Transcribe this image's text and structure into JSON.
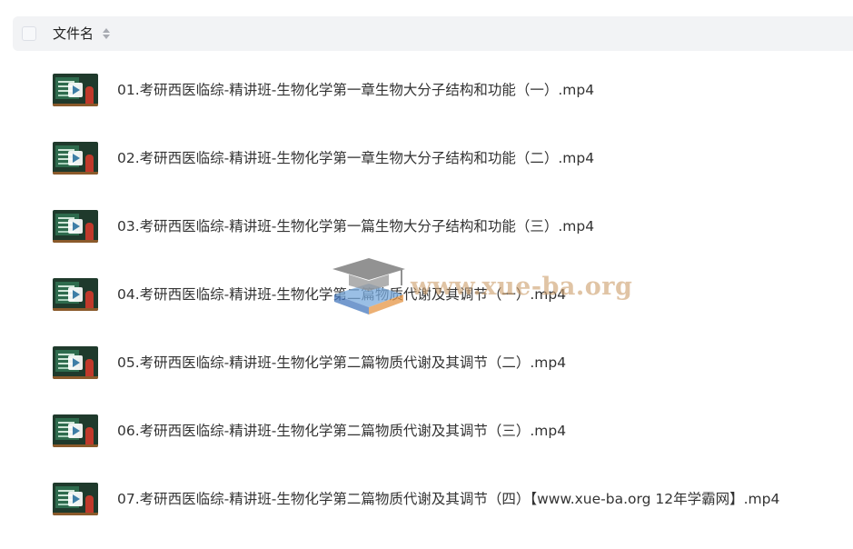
{
  "header": {
    "column_title": "文件名",
    "sort_icon": "sort-both-icon"
  },
  "files": [
    {
      "name": "01.考研西医临综-精讲班-生物化学第一章生物大分子结构和功能（一）.mp4"
    },
    {
      "name": "02.考研西医临综-精讲班-生物化学第一章生物大分子结构和功能（二）.mp4"
    },
    {
      "name": "03.考研西医临综-精讲班-生物化学第一篇生物大分子结构和功能（三）.mp4"
    },
    {
      "name": "04.考研西医临综-精讲班-生物化学第二篇物质代谢及其调节（一）.mp4"
    },
    {
      "name": "05.考研西医临综-精讲班-生物化学第二篇物质代谢及其调节（二）.mp4"
    },
    {
      "name": "06.考研西医临综-精讲班-生物化学第二篇物质代谢及其调节（三）.mp4"
    },
    {
      "name": "07.考研西医临综-精讲班-生物化学第二篇物质代谢及其调节（四）【www.xue-ba.org 12年学霸网】.mp4"
    }
  ],
  "watermark": {
    "text": "www.xue-ba.org",
    "icon": "graduation-cap-book-icon"
  },
  "colors": {
    "header_bg": "#f2f3f5",
    "text": "#333333",
    "watermark": "#cda06e"
  }
}
